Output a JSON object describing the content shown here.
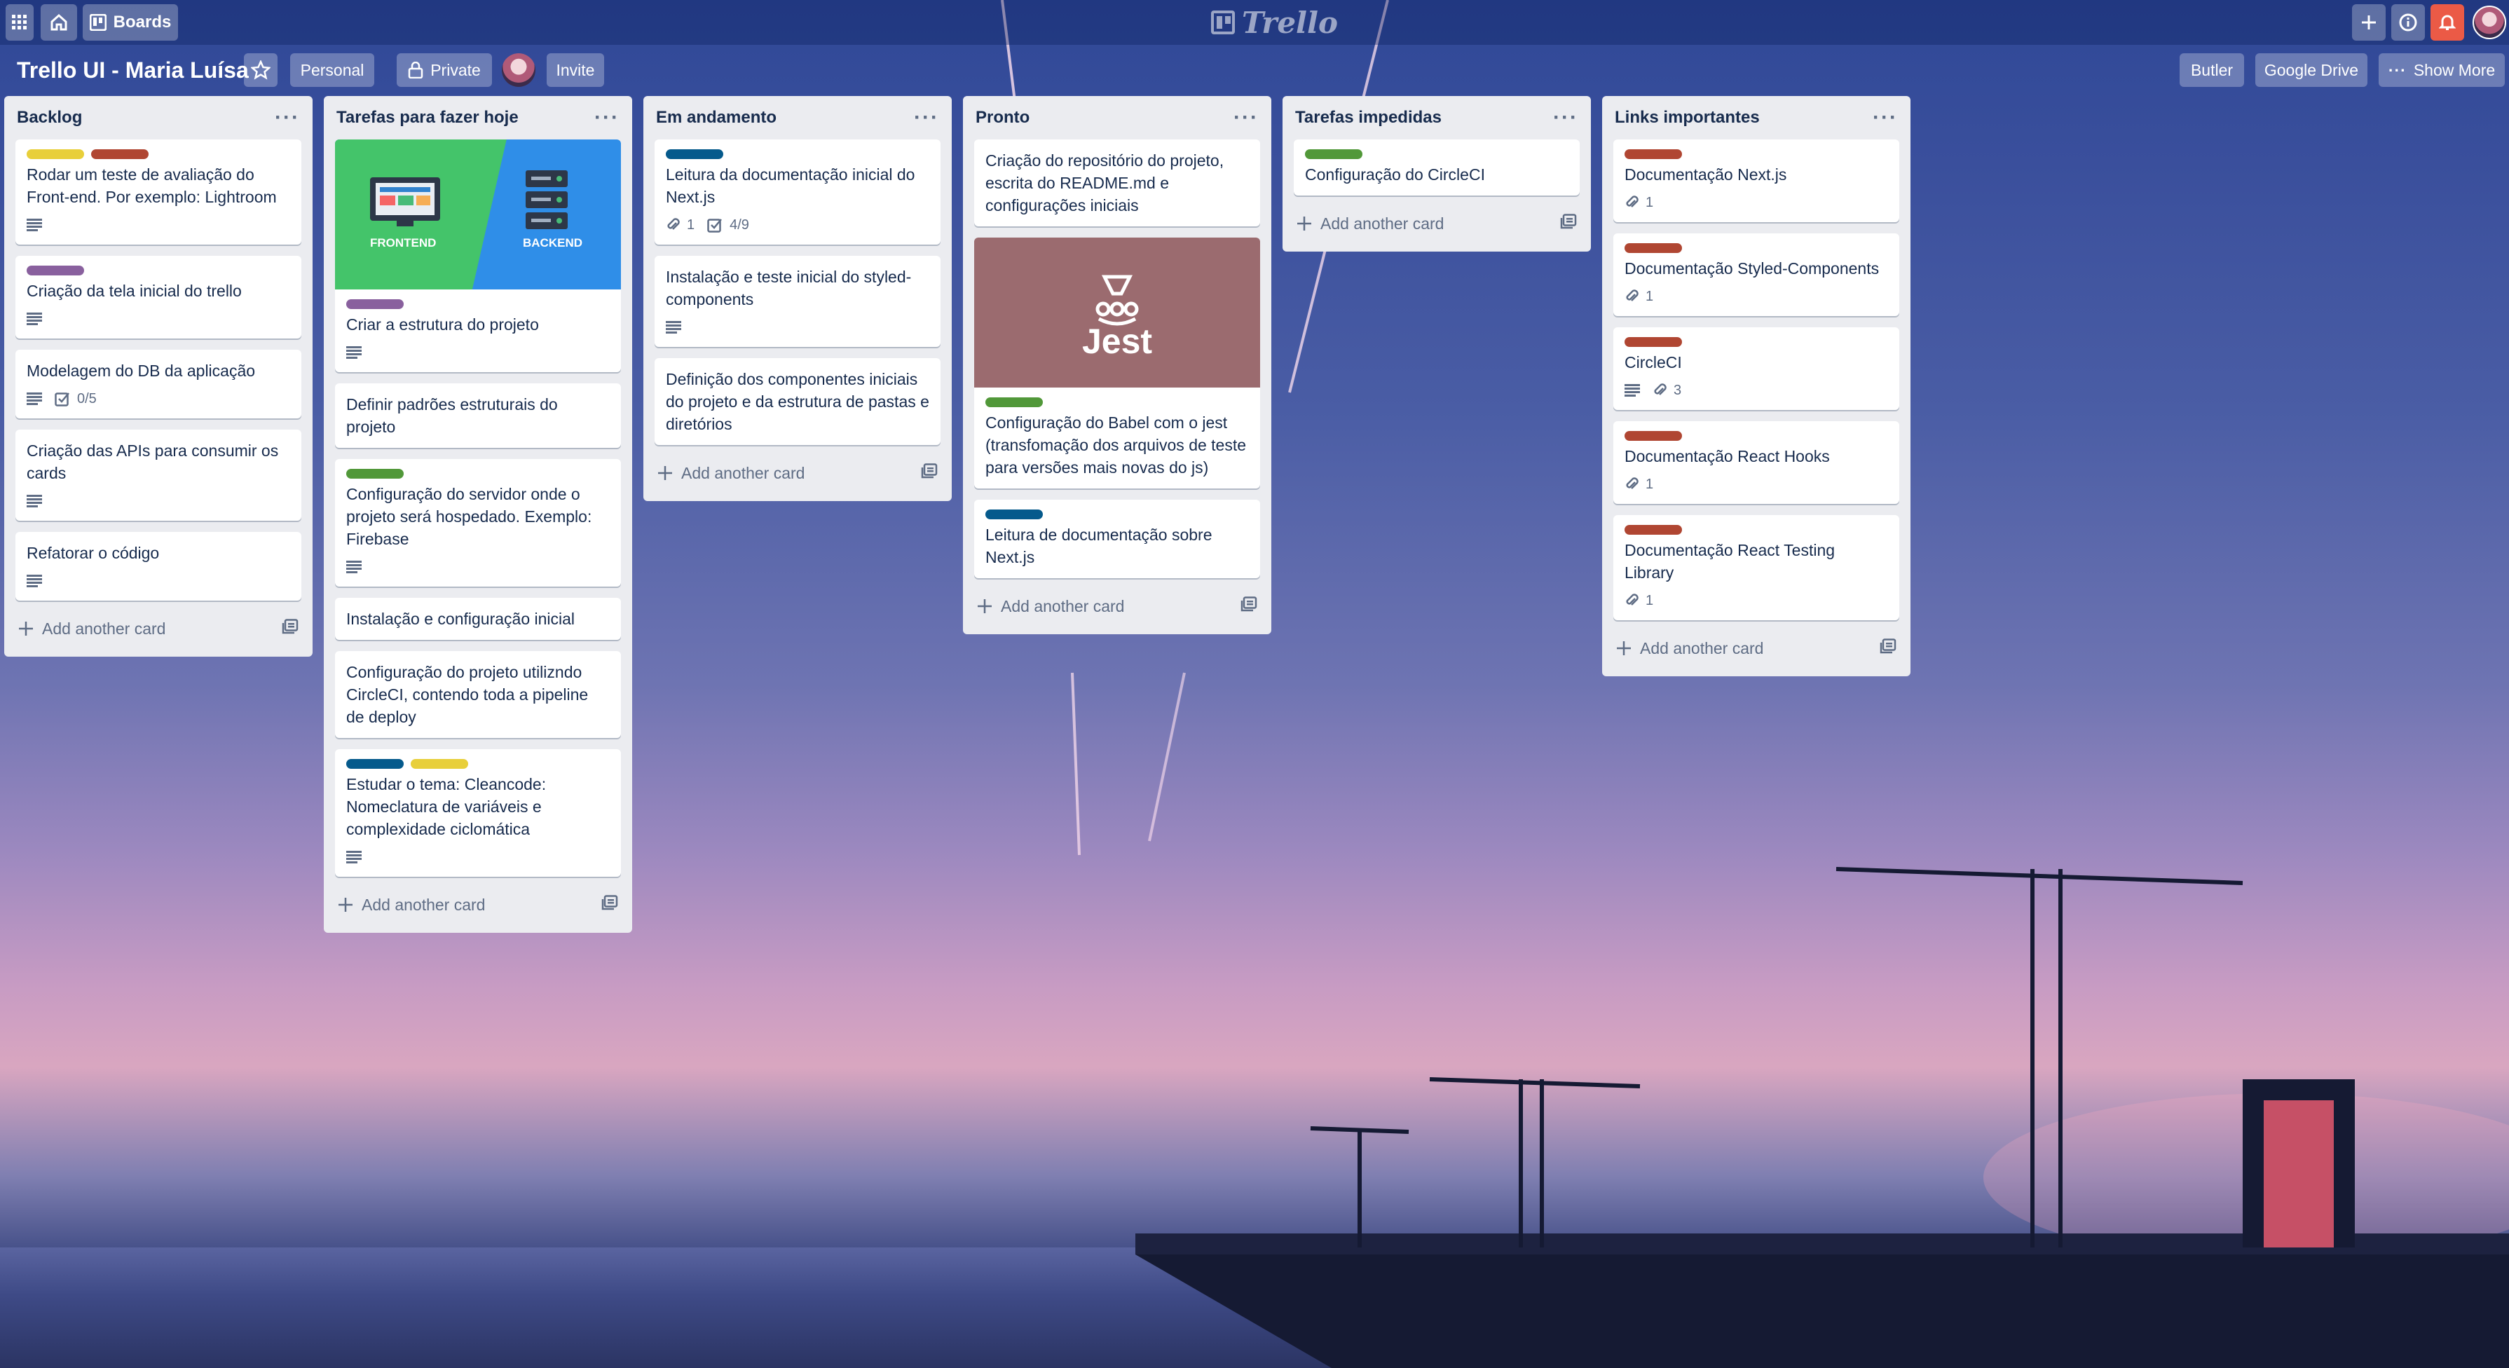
{
  "topbar": {
    "apps_icon": "grid-icon",
    "home_icon": "home-icon",
    "boards_label": "Boards",
    "logo_text": "Trello",
    "right_icons": [
      "plus-icon",
      "info-icon",
      "bell-icon",
      "avatar"
    ]
  },
  "board": {
    "title": "Trello UI - Maria Luísa",
    "personal_label": "Personal",
    "private_label": "Private",
    "invite_label": "Invite",
    "butler_label": "Butler",
    "drive_label": "Google Drive",
    "show_more_label": "Show More"
  },
  "colors": {
    "yellow": "#f2d600",
    "red": "#eb5a46",
    "purple": "#c377e0",
    "green": "#61bd4f",
    "blue": "#0079bf",
    "darkred": "#b04632",
    "navy": "#055a8c"
  },
  "lists": [
    {
      "title": "Backlog",
      "add_label": "Add another card",
      "cards": [
        {
          "labels": [
            "#e8cf3a",
            "#b04632"
          ],
          "text": "Rodar um teste de avaliação do Front-end. Por exemplo: Lightroom",
          "desc": true
        },
        {
          "labels": [
            "#89609e"
          ],
          "text": "Criação da tela inicial do trello",
          "desc": true
        },
        {
          "labels": [],
          "text": "Modelagem do DB da aplicação",
          "desc": true,
          "checklist": "0/5"
        },
        {
          "labels": [],
          "text": "Criação das APIs para consumir os cards",
          "desc": true
        },
        {
          "labels": [],
          "text": "Refatorar o código",
          "desc": true
        }
      ]
    },
    {
      "title": "Tarefas para fazer hoje",
      "add_label": "Add another card",
      "cards": [
        {
          "cover": "frontend-backend",
          "cover_left": "FRONTEND",
          "cover_right": "BACKEND",
          "labels": [
            "#89609e"
          ],
          "text": "Criar a estrutura do projeto",
          "desc": true
        },
        {
          "labels": [],
          "text": "Definir padrões estruturais do projeto"
        },
        {
          "labels": [
            "#519839"
          ],
          "text": "Configuração do servidor onde o projeto será hospedado. Exemplo: Firebase",
          "desc": true
        },
        {
          "labels": [],
          "text": "Instalação e configuração inicial"
        },
        {
          "labels": [],
          "text": "Configuração do projeto utilizndo CircleCI, contendo toda a pipeline de deploy"
        },
        {
          "labels": [
            "#055a8c",
            "#e8cf3a"
          ],
          "text": "Estudar o tema: Cleancode: Nomeclatura de variáveis e complexidade ciclomática",
          "desc": true
        }
      ]
    },
    {
      "title": "Em andamento",
      "add_label": "Add another card",
      "cards": [
        {
          "labels": [
            "#055a8c"
          ],
          "text": "Leitura da documentação inicial do Next.js",
          "attach": "1",
          "checklist": "4/9"
        },
        {
          "labels": [],
          "text": "Instalação e teste inicial do styled-components",
          "desc": true
        },
        {
          "labels": [],
          "text": "Definição dos componentes iniciais do projeto e da estrutura de pastas e diretórios"
        }
      ]
    },
    {
      "title": "Pronto",
      "add_label": "Add another card",
      "cards": [
        {
          "labels": [],
          "text": "Criação do repositório do projeto, escrita do README.md e configurações iniciais"
        },
        {
          "cover": "jest",
          "cover_text": "Jest",
          "labels": [
            "#519839"
          ],
          "text": "Configuração do Babel com o jest (transfomação dos arquivos de teste para versões mais novas do js)"
        },
        {
          "labels": [
            "#055a8c"
          ],
          "text": "Leitura de documentação sobre Next.js"
        }
      ]
    },
    {
      "title": "Tarefas impedidas",
      "add_label": "Add another card",
      "cards": [
        {
          "labels": [
            "#519839"
          ],
          "text": "Configuração do CircleCI"
        }
      ]
    },
    {
      "title": "Links importantes",
      "add_label": "Add another card",
      "cards": [
        {
          "labels": [
            "#b04632"
          ],
          "text": "Documentação Next.js",
          "attach": "1"
        },
        {
          "labels": [
            "#b04632"
          ],
          "text": "Documentação Styled-Components",
          "attach": "1"
        },
        {
          "labels": [
            "#b04632"
          ],
          "text": "CircleCI",
          "desc": true,
          "attach": "3"
        },
        {
          "labels": [
            "#b04632"
          ],
          "text": "Documentação React Hooks",
          "attach": "1"
        },
        {
          "labels": [
            "#b04632"
          ],
          "text": "Documentação React Testing Library",
          "attach": "1"
        }
      ]
    }
  ]
}
